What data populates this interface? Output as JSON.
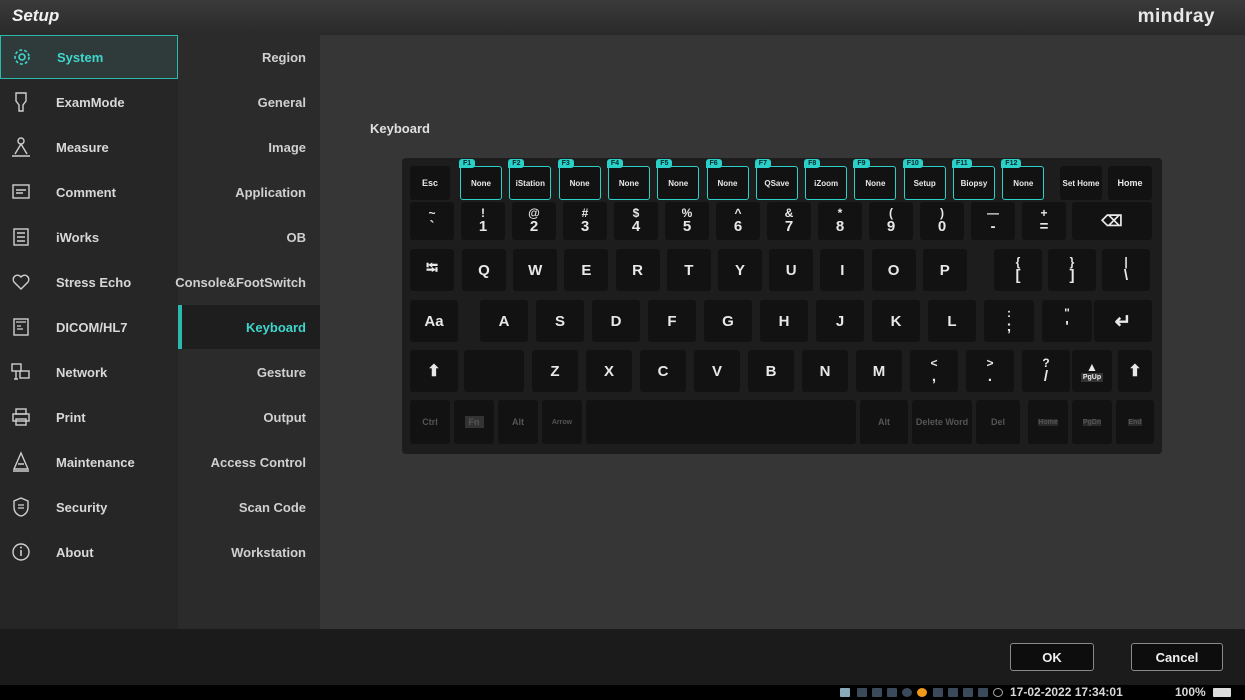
{
  "app_title": "Setup",
  "brand": "mindray",
  "accent_color": "#2bd0c8",
  "sidebar": {
    "items": [
      {
        "label": "System",
        "icon": "gear-icon",
        "active": true
      },
      {
        "label": "ExamMode",
        "icon": "probe-icon",
        "active": false
      },
      {
        "label": "Measure",
        "icon": "measure-icon",
        "active": false
      },
      {
        "label": "Comment",
        "icon": "comment-icon",
        "active": false
      },
      {
        "label": "iWorks",
        "icon": "list-icon",
        "active": false
      },
      {
        "label": "Stress Echo",
        "icon": "heart-icon",
        "active": false
      },
      {
        "label": "DICOM/HL7",
        "icon": "dicom-icon",
        "active": false
      },
      {
        "label": "Network",
        "icon": "network-icon",
        "active": false
      },
      {
        "label": "Print",
        "icon": "printer-icon",
        "active": false
      },
      {
        "label": "Maintenance",
        "icon": "maintenance-icon",
        "active": false
      },
      {
        "label": "Security",
        "icon": "shield-icon",
        "active": false
      },
      {
        "label": "About",
        "icon": "info-icon",
        "active": false
      }
    ]
  },
  "submenu": {
    "items": [
      "Region",
      "General",
      "Image",
      "Application",
      "OB",
      "Console&FootSwitch",
      "Keyboard",
      "Gesture",
      "Output",
      "Access Control",
      "Scan Code",
      "Workstation"
    ],
    "active_index": 6
  },
  "section_label": "Keyboard",
  "keyboard": {
    "esc": "Esc",
    "fkeys": [
      {
        "tag": "F1",
        "label": "None"
      },
      {
        "tag": "F2",
        "label": "iStation"
      },
      {
        "tag": "F3",
        "label": "None"
      },
      {
        "tag": "F4",
        "label": "None"
      },
      {
        "tag": "F5",
        "label": "None"
      },
      {
        "tag": "F6",
        "label": "None"
      },
      {
        "tag": "F7",
        "label": "QSave"
      },
      {
        "tag": "F8",
        "label": "iZoom"
      },
      {
        "tag": "F9",
        "label": "None"
      },
      {
        "tag": "F10",
        "label": "Setup"
      },
      {
        "tag": "F11",
        "label": "Biopsy"
      },
      {
        "tag": "F12",
        "label": "None"
      }
    ],
    "set_home": "Set Home",
    "home": "Home",
    "number_row": [
      {
        "top": "~",
        "bot": "`"
      },
      {
        "top": "!",
        "bot": "1"
      },
      {
        "top": "@",
        "bot": "2"
      },
      {
        "top": "#",
        "bot": "3"
      },
      {
        "top": "$",
        "bot": "4"
      },
      {
        "top": "%",
        "bot": "5"
      },
      {
        "top": "^",
        "bot": "6"
      },
      {
        "top": "&",
        "bot": "7"
      },
      {
        "top": "*",
        "bot": "8"
      },
      {
        "top": "(",
        "bot": "9"
      },
      {
        "top": ")",
        "bot": "0"
      },
      {
        "top": "—",
        "bot": "-"
      },
      {
        "top": "+",
        "bot": "="
      }
    ],
    "backspace": "⌫",
    "tab": "⭾",
    "row_q": [
      "Q",
      "W",
      "E",
      "R",
      "T",
      "Y",
      "U",
      "I",
      "O",
      "P"
    ],
    "row_q_extra": [
      {
        "top": "{",
        "bot": "["
      },
      {
        "top": "}",
        "bot": "]"
      },
      {
        "top": "|",
        "bot": "\\"
      }
    ],
    "caps": "Aa",
    "row_a": [
      "A",
      "S",
      "D",
      "F",
      "G",
      "H",
      "J",
      "K",
      "L"
    ],
    "row_a_extra": [
      {
        "top": ":",
        "bot": ";"
      },
      {
        "top": "\"",
        "bot": "'"
      }
    ],
    "enter": "↵",
    "shift": "⬆",
    "row_z": [
      "Z",
      "X",
      "C",
      "V",
      "B",
      "N",
      "M"
    ],
    "row_z_extra": [
      {
        "top": "<",
        "bot": ","
      },
      {
        "top": ">",
        "bot": "."
      },
      {
        "top": "?",
        "bot": "/"
      }
    ],
    "pgup_arrow": "▲",
    "pgup": "PgUp",
    "ctrl": "Ctrl",
    "fn": "Fn",
    "alt": "Alt",
    "arrow": "Arrow",
    "alt_right": "Alt",
    "delete_word": "Delete Word",
    "del": "Del",
    "home_bottom": "Home",
    "pgdn": "PgDn",
    "end": "End"
  },
  "buttons": {
    "ok": "OK",
    "cancel": "Cancel"
  },
  "status": {
    "datetime": "17-02-2022 17:34:01",
    "zoom": "100%"
  }
}
